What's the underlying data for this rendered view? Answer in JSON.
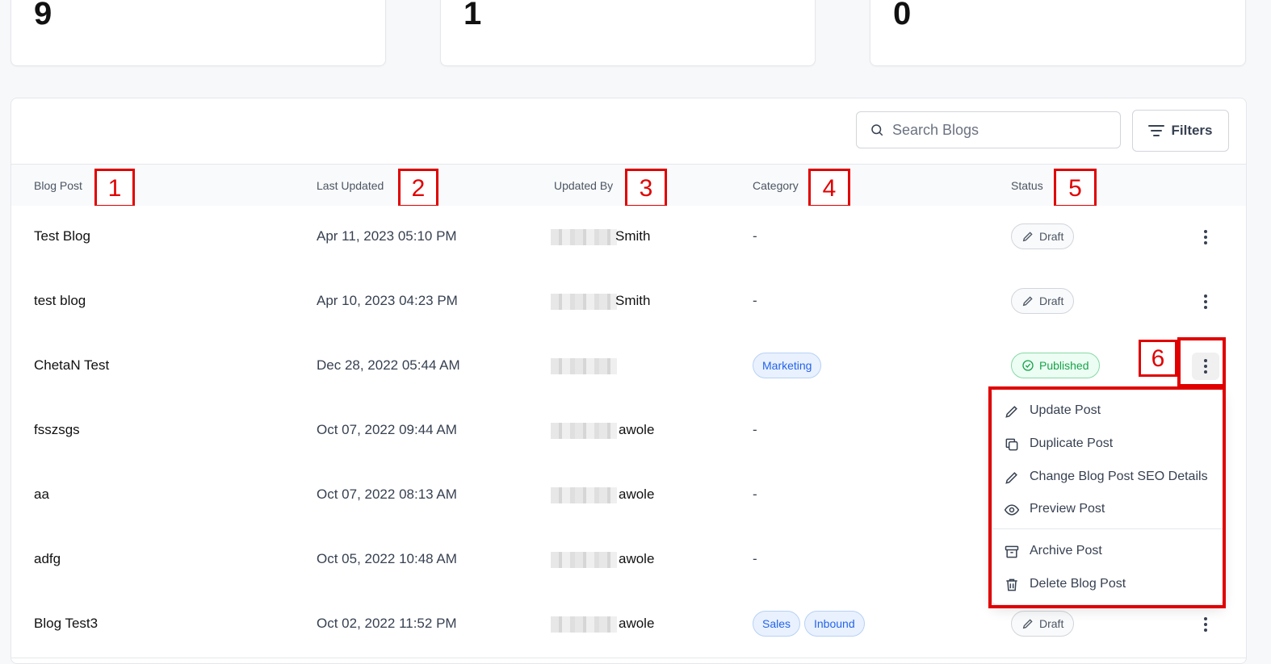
{
  "stats": [
    {
      "value": "9"
    },
    {
      "value": "1"
    },
    {
      "value": "0"
    }
  ],
  "toolbar": {
    "search_placeholder": "Search Blogs",
    "filters_label": "Filters"
  },
  "columns": {
    "blog_post": "Blog Post",
    "last_updated": "Last Updated",
    "updated_by": "Updated By",
    "category": "Category",
    "status": "Status"
  },
  "annotations": [
    "1",
    "2",
    "3",
    "4",
    "5",
    "6"
  ],
  "rows": [
    {
      "title": "Test Blog",
      "updated": "Apr 11, 2023 05:10 PM",
      "by_suffix": "Smith",
      "category": "-",
      "status": "Draft"
    },
    {
      "title": "test blog",
      "updated": "Apr 10, 2023 04:23 PM",
      "by_suffix": "Smith",
      "category": "-",
      "status": "Draft"
    },
    {
      "title": "ChetaN Test",
      "updated": "Dec 28, 2022 05:44 AM",
      "by_suffix": "",
      "category": "Marketing",
      "status": "Published"
    },
    {
      "title": "fsszsgs",
      "updated": "Oct 07, 2022 09:44 AM",
      "by_suffix": "awole",
      "category": "-",
      "status": ""
    },
    {
      "title": "aa",
      "updated": "Oct 07, 2022 08:13 AM",
      "by_suffix": "awole",
      "category": "-",
      "status": ""
    },
    {
      "title": "adfg",
      "updated": "Oct 05, 2022 10:48 AM",
      "by_suffix": "awole",
      "category": "-",
      "status": ""
    },
    {
      "title": "Blog Test3",
      "updated": "Oct 02, 2022 11:52 PM",
      "by_suffix": "awole",
      "categories": [
        "Sales",
        "Inbound"
      ],
      "status": "Draft"
    }
  ],
  "menu": {
    "update_post": "Update Post",
    "duplicate_post": "Duplicate Post",
    "change_seo": "Change Blog Post SEO Details",
    "preview_post": "Preview Post",
    "archive_post": "Archive Post",
    "delete_post": "Delete Blog Post"
  },
  "colors": {
    "annotation_red": "#e00000",
    "published_green": "#16a34a",
    "tag_blue": "#2563eb"
  }
}
